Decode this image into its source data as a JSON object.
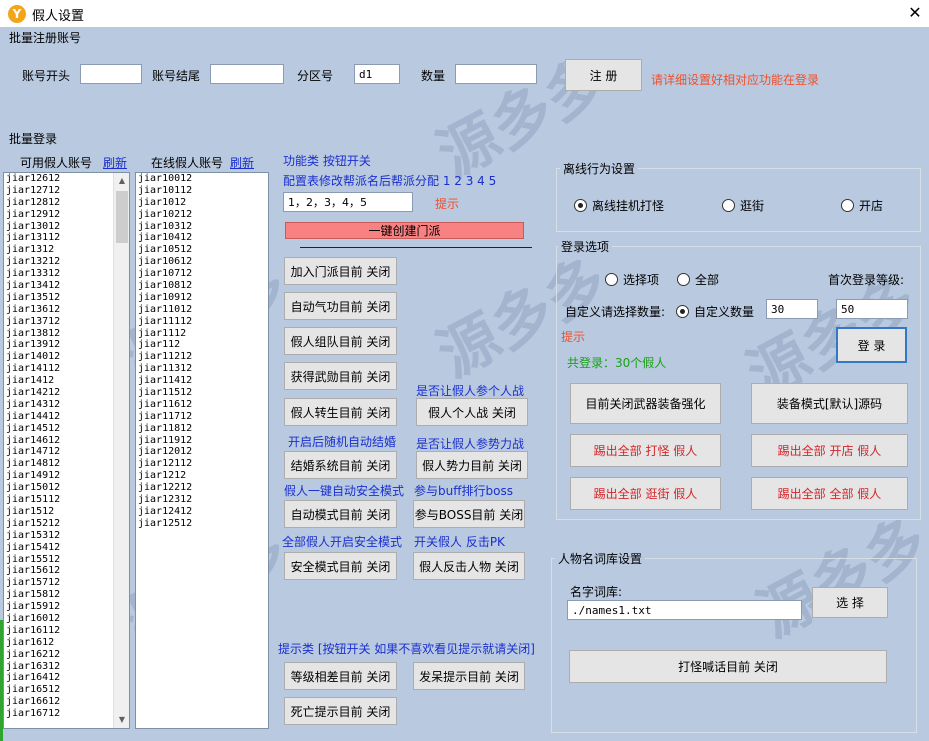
{
  "window": {
    "title": "假人设置",
    "app_icon": "Y",
    "close_glyph": "✕"
  },
  "watermark": "源多多",
  "batch_register": {
    "title": "批量注册账号",
    "account_prefix_label": "账号开头",
    "account_prefix_value": "",
    "account_suffix_label": "账号结尾",
    "account_suffix_value": "",
    "zone_label": "分区号",
    "zone_value": "d1",
    "count_label": "数量",
    "count_value": "",
    "register_button": "注  册",
    "hint": "请详细设置好相对应功能在登录"
  },
  "batch_login": {
    "title": "批量登录",
    "available_label": "可用假人账号",
    "available_refresh": "刷新",
    "online_label": "在线假人账号",
    "online_refresh": "刷新",
    "available_accounts": [
      "jiar12612",
      "jiar12712",
      "jiar12812",
      "jiar12912",
      "jiar13012",
      "jiar13112",
      "jiar1312",
      "jiar13212",
      "jiar13312",
      "jiar13412",
      "jiar13512",
      "jiar13612",
      "jiar13712",
      "jiar13812",
      "jiar13912",
      "jiar14012",
      "jiar14112",
      "jiar1412",
      "jiar14212",
      "jiar14312",
      "jiar14412",
      "jiar14512",
      "jiar14612",
      "jiar14712",
      "jiar14812",
      "jiar14912",
      "jiar15012",
      "jiar15112",
      "jiar1512",
      "jiar15212",
      "jiar15312",
      "jiar15412",
      "jiar15512",
      "jiar15612",
      "jiar15712",
      "jiar15812",
      "jiar15912",
      "jiar16012",
      "jiar16112",
      "jiar1612",
      "jiar16212",
      "jiar16312",
      "jiar16412",
      "jiar16512",
      "jiar16612",
      "jiar16712"
    ],
    "online_accounts": [
      "jiar10012",
      "jiar10112",
      "jiar1012",
      "jiar10212",
      "jiar10312",
      "jiar10412",
      "jiar10512",
      "jiar10612",
      "jiar10712",
      "jiar10812",
      "jiar10912",
      "jiar11012",
      "jiar11112",
      "jiar1112",
      "jiar112",
      "jiar11212",
      "jiar11312",
      "jiar11412",
      "jiar11512",
      "jiar11612",
      "jiar11712",
      "jiar11812",
      "jiar11912",
      "jiar12012",
      "jiar12112",
      "jiar1212",
      "jiar12212",
      "jiar12312",
      "jiar12412",
      "jiar12512"
    ]
  },
  "functions": {
    "title": "功能类 按钮开关",
    "faction_config_label": "配置表修改帮派名后帮派分配 1 2 3 4 5",
    "faction_input_value": "1，2，3，4，5",
    "faction_hint": "提示",
    "create_faction_button": "一键创建门派",
    "join_faction_button": "加入门派目前 关闭",
    "auto_qigong_button": "自动气功目前 关闭",
    "team_button": "假人组队目前 关闭",
    "martial_button": "获得武勋目前 关闭",
    "personal_battle_label": "是否让假人参个人战",
    "rebirth_button": "假人转生目前 关闭",
    "personal_battle_button": "假人个人战 关闭",
    "marriage_label": "开启后随机自动结婚",
    "force_battle_label": "是否让假人参势力战",
    "marriage_button": "结婚系统目前 关闭",
    "force_battle_button": "假人势力目前 关闭",
    "safe_auto_label": "假人一键自动安全模式",
    "buff_rank_label": "参与buff排行boss",
    "auto_mode_button": "自动模式目前 关闭",
    "boss_button": "参与BOSS目前 关闭",
    "safe_all_label": "全部假人开启安全模式",
    "pk_label": "开关假人 反击PK",
    "safe_mode_button": "安全模式目前 关闭",
    "counter_button": "假人反击人物 关闭",
    "tips_label": "提示类 [按钮开关 如果不喜欢看见提示就请关闭]",
    "level_tip_button": "等级相差目前 关闭",
    "idle_tip_button": "发呆提示目前 关闭",
    "death_tip_button": "死亡提示目前 关闭"
  },
  "offline": {
    "title": "离线行为设置",
    "options": [
      "离线挂机打怪",
      "逛街",
      "开店"
    ],
    "selected": 0
  },
  "login_options": {
    "title": "登录选项",
    "option_select": "选择项",
    "option_all": "全部",
    "first_level_label": "首次登录等级:",
    "custom_label": "自定义请选择数量:",
    "custom_option": "自定义数量",
    "custom_selected": true,
    "custom_count_value": "30",
    "first_level_value": "50",
    "hint": "提示",
    "login_button": "登 录",
    "total_login": "共登录：30个假人",
    "weapon_button": "目前关闭武器装备强化",
    "equip_button": "装备模式[默认]源码",
    "kick_monster_button": "踢出全部 打怪 假人",
    "kick_shop_button": "踢出全部 开店 假人",
    "kick_stroll_button": "踢出全部 逛街 假人",
    "kick_all_button": "踢出全部 全部 假人"
  },
  "name_library": {
    "title": "人物名词库设置",
    "label": "名字词库:",
    "path_value": "./names1.txt",
    "select_button": "选 择",
    "shout_button": "打怪喊话目前 关闭"
  }
}
